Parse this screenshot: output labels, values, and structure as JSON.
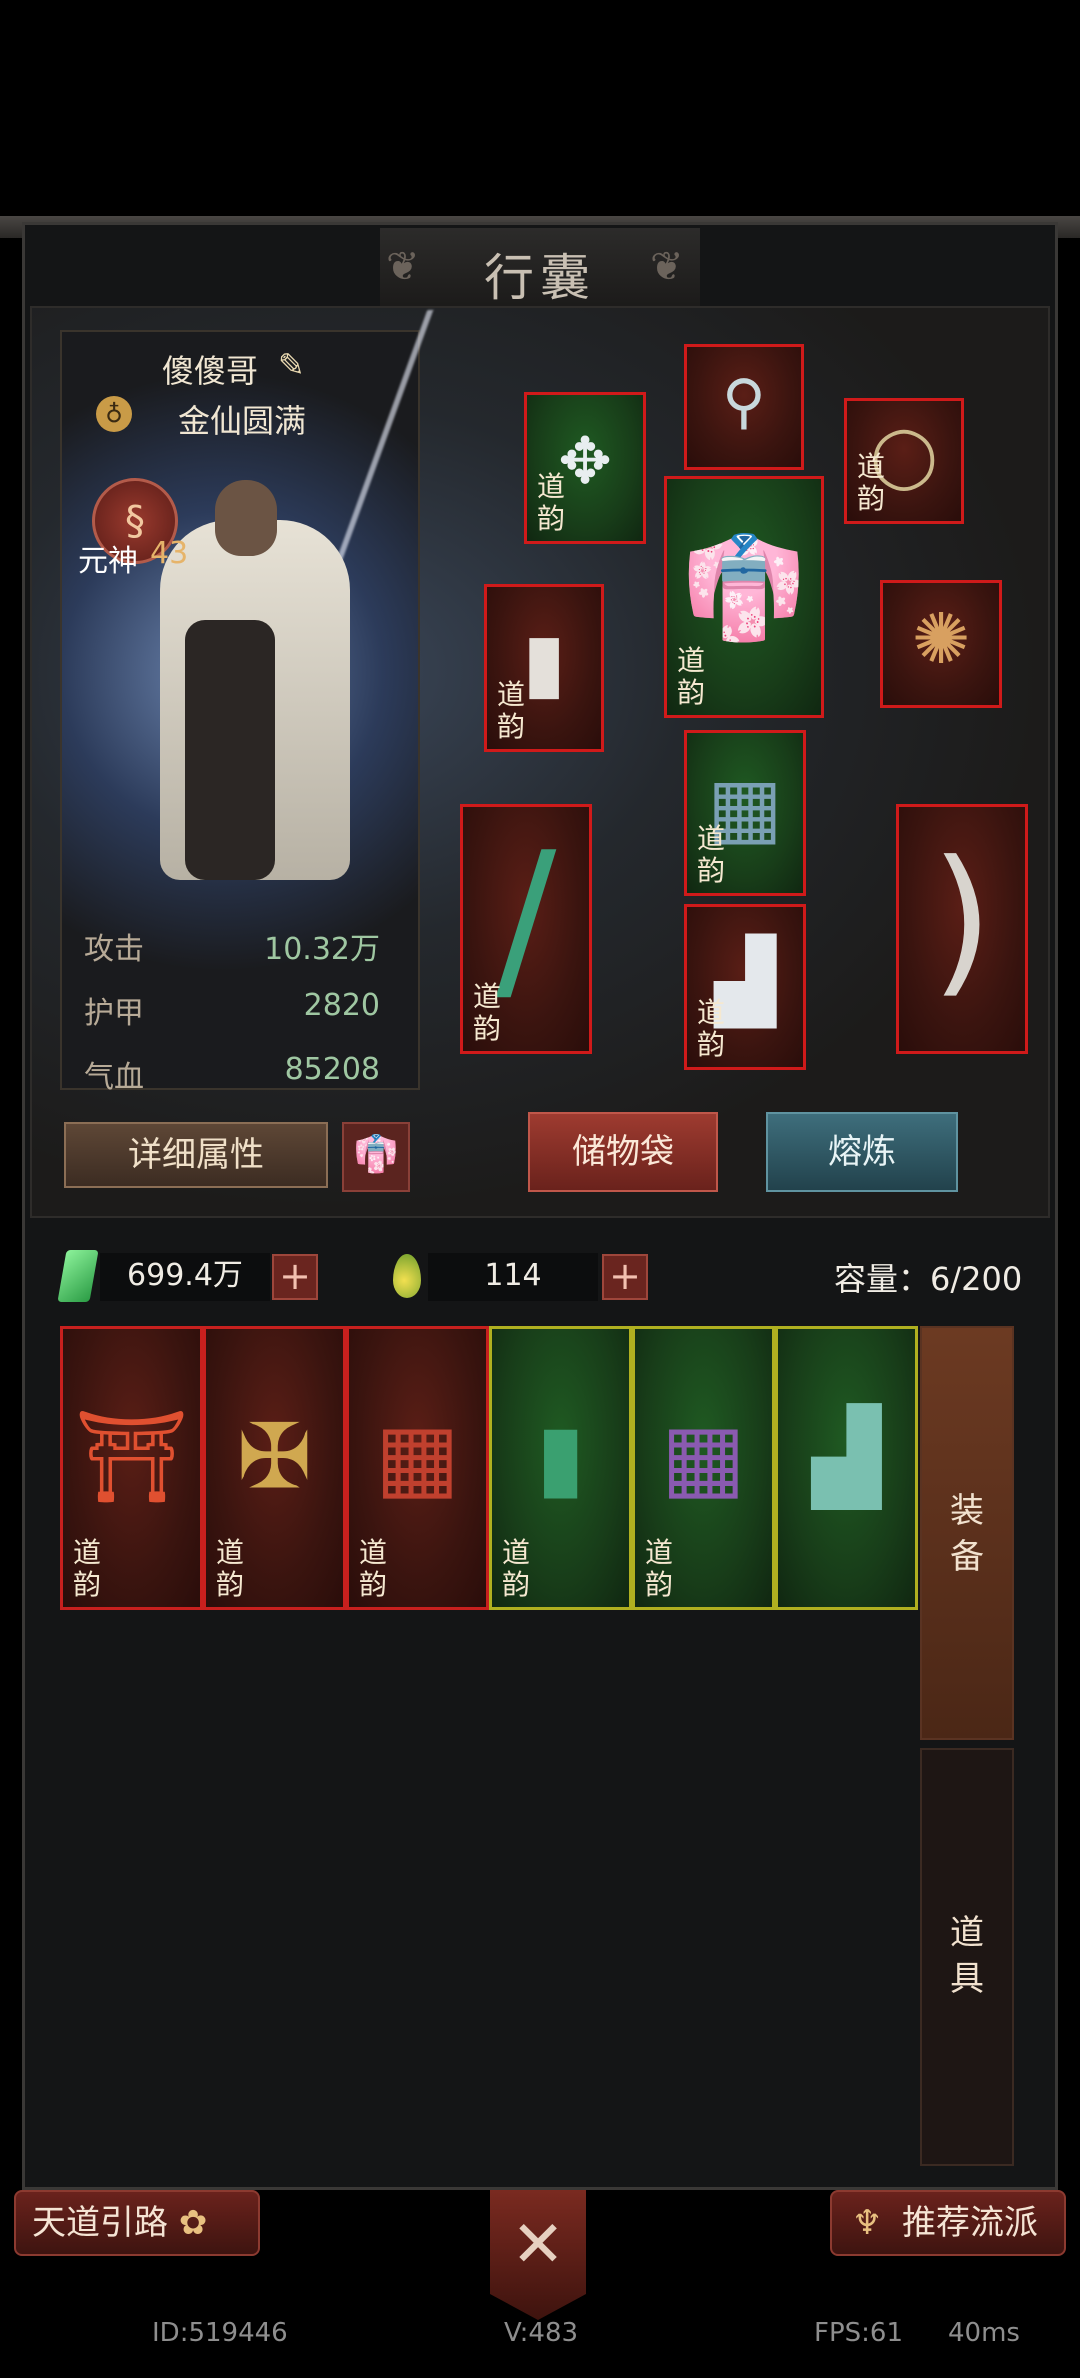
{
  "panel": {
    "title": "行囊"
  },
  "character": {
    "name": "傻傻哥",
    "realm": "金仙圆满",
    "soul_label": "元神",
    "soul_value": "43",
    "stats": [
      {
        "label": "攻击",
        "value": "10.32万"
      },
      {
        "label": "护甲",
        "value": "2820"
      },
      {
        "label": "气血",
        "value": "85208"
      }
    ]
  },
  "buttons": {
    "detail": "详细属性",
    "bag": "储物袋",
    "smelt": "熔炼"
  },
  "equip_slots": [
    {
      "name": "pendant-slot",
      "tag": "道韵",
      "glyph": "✥",
      "bg": "green"
    },
    {
      "name": "hairpin-slot",
      "tag": "",
      "glyph": "⚲",
      "bg": "red"
    },
    {
      "name": "necklace-slot",
      "tag": "道韵",
      "glyph": "◯",
      "bg": "red"
    },
    {
      "name": "bracer-slot",
      "tag": "道韵",
      "glyph": "▮",
      "bg": "red"
    },
    {
      "name": "robe-slot",
      "tag": "道韵",
      "glyph": "👘",
      "bg": "green"
    },
    {
      "name": "ring-slot",
      "tag": "",
      "glyph": "✺",
      "bg": "red"
    },
    {
      "name": "sword-slot",
      "tag": "道韵",
      "glyph": "/",
      "bg": "red"
    },
    {
      "name": "pants-slot",
      "tag": "道韵",
      "glyph": "▦",
      "bg": "green"
    },
    {
      "name": "boots-slot",
      "tag": "道韵",
      "glyph": "▟",
      "bg": "red"
    },
    {
      "name": "bow-slot",
      "tag": "",
      "glyph": ")",
      "bg": "red"
    }
  ],
  "resources": {
    "crystal": "699.4万",
    "essence": "114",
    "capacity": "容量：6/200"
  },
  "inventory": [
    {
      "tag": "道韵",
      "glyph": "⛩",
      "tier": "red",
      "icon": "hat-icon"
    },
    {
      "tag": "道韵",
      "glyph": "✠",
      "tier": "red",
      "icon": "lantern-icon"
    },
    {
      "tag": "道韵",
      "glyph": "▦",
      "tier": "red",
      "icon": "pants-icon"
    },
    {
      "tag": "道韵",
      "glyph": "▮",
      "tier": "green",
      "icon": "bracer-icon"
    },
    {
      "tag": "道韵",
      "glyph": "▦",
      "tier": "green",
      "icon": "pants-icon"
    },
    {
      "tag": "",
      "glyph": "▟",
      "tier": "green",
      "icon": "boots-icon"
    }
  ],
  "side_tabs": {
    "equip": "装备",
    "item": "道具"
  },
  "footer": {
    "left": "天道引路",
    "right": "推荐流派"
  },
  "info": {
    "id": "ID:519446",
    "version": "V:483",
    "fps": "FPS:61",
    "latency": "40ms"
  }
}
